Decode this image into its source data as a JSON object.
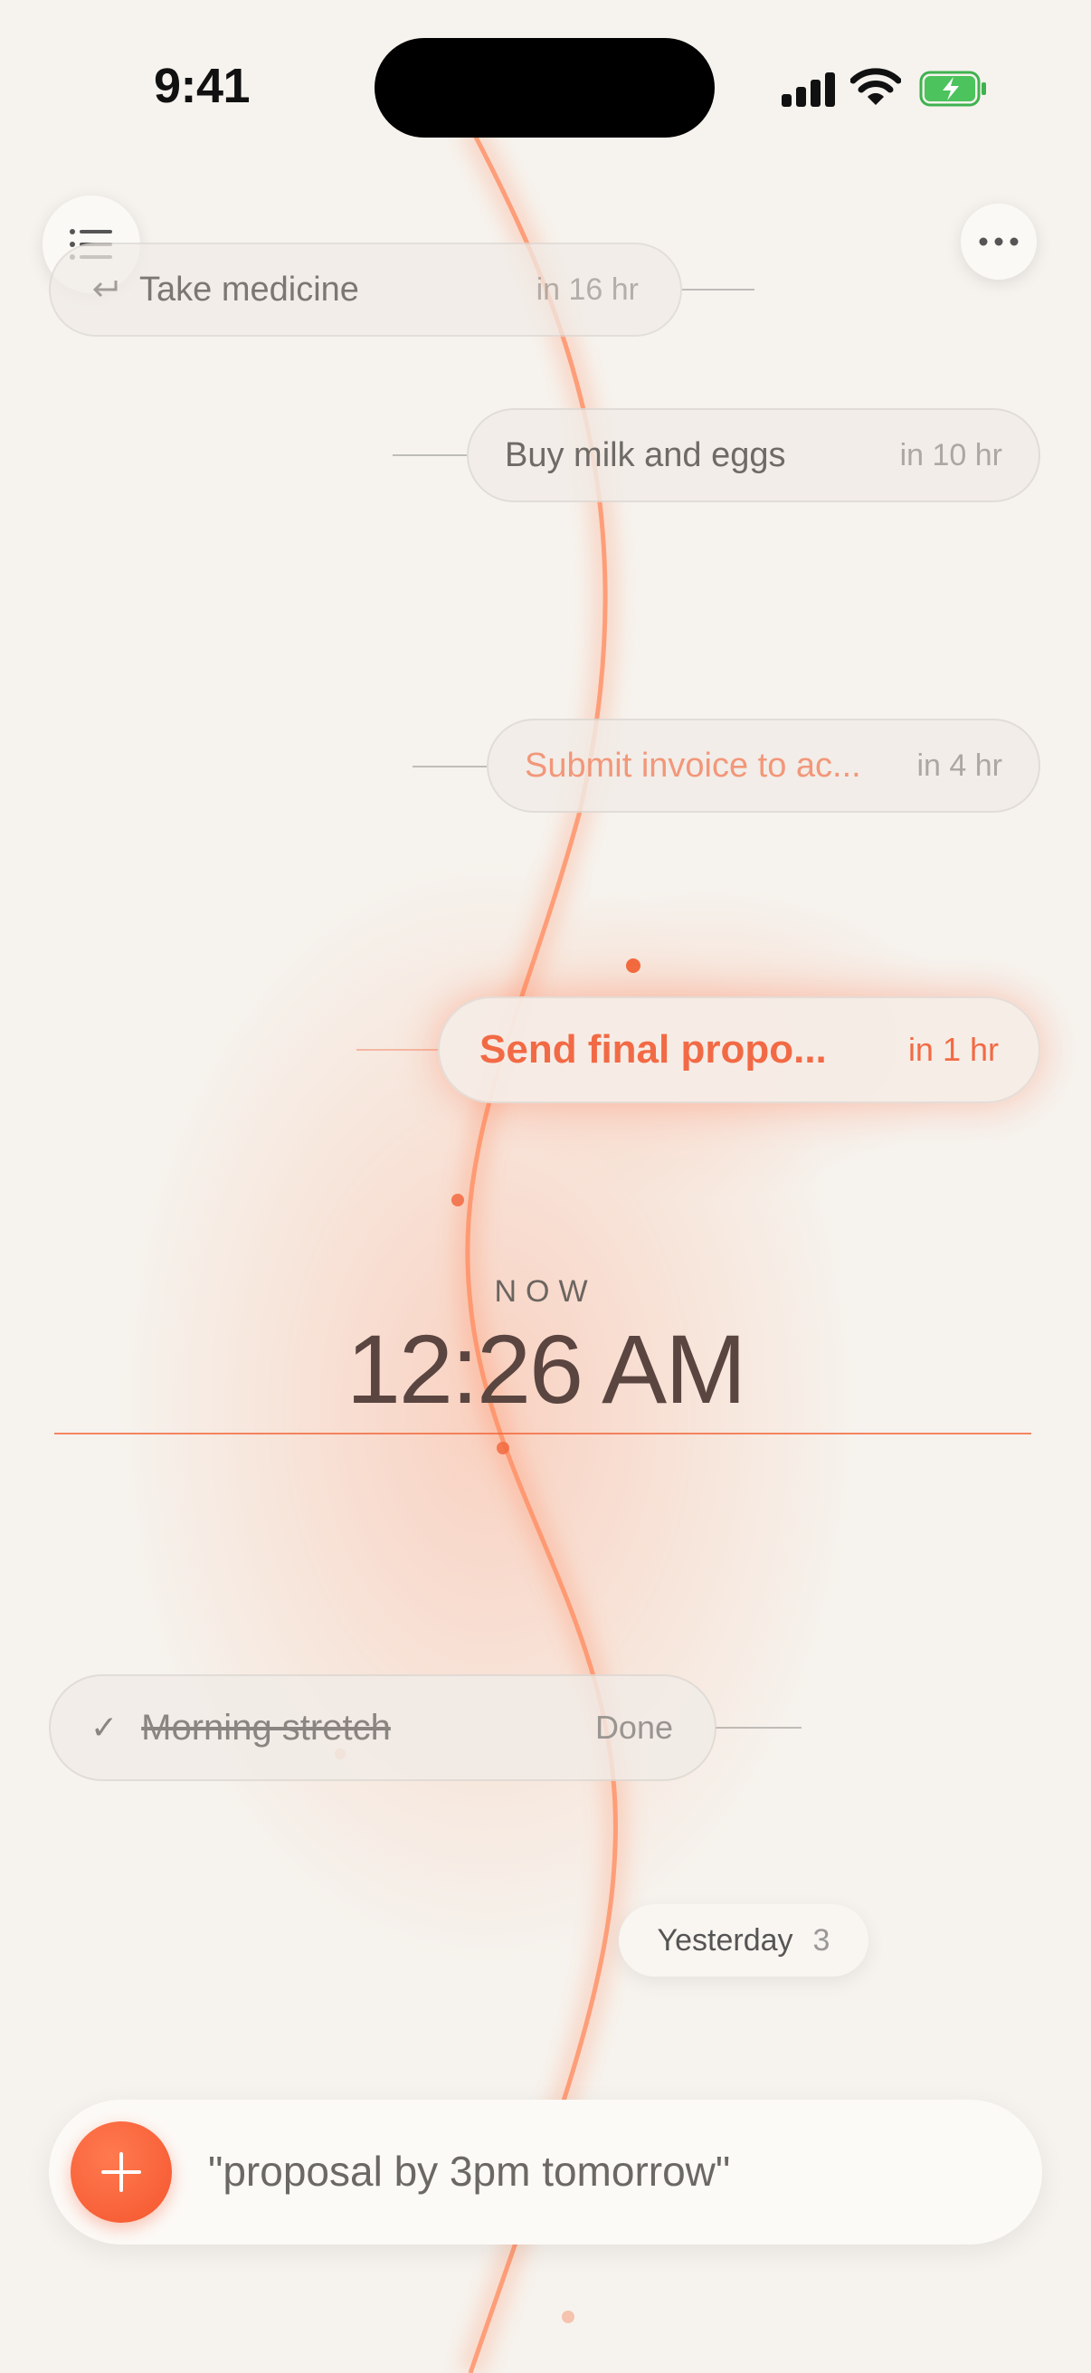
{
  "status_bar": {
    "time": "9:41"
  },
  "icons": {
    "menu": "list-icon",
    "more": "ellipsis-icon",
    "repeat": "return-arrow-icon",
    "done": "checkmark-icon",
    "add": "plus-icon"
  },
  "tasks": [
    {
      "title": "Take medicine",
      "due": "in 16 hr",
      "repeating": true
    },
    {
      "title": "Buy milk and eggs",
      "due": "in 10 hr"
    },
    {
      "title": "Submit invoice to ac...",
      "due": "in 4 hr"
    },
    {
      "title": "Send final propo...",
      "due": "in 1 hr"
    }
  ],
  "now": {
    "label": "NOW",
    "time": "12:26 AM"
  },
  "done_tasks": [
    {
      "title": "Morning stretch",
      "status": "Done",
      "check": "✓"
    }
  ],
  "history": {
    "label": "Yesterday",
    "count": "3"
  },
  "composer": {
    "placeholder": "\"proposal by 3pm tomorrow\""
  },
  "colors": {
    "accent": "#f5623a",
    "background": "#f6f3ee",
    "pill": "#f0ece7"
  }
}
